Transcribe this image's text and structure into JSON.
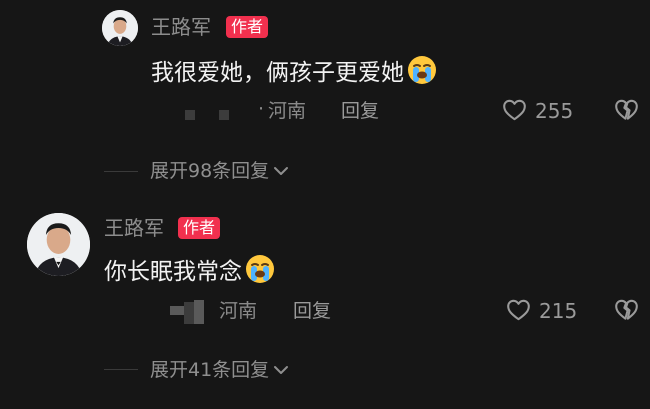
{
  "comments": [
    {
      "author": "王路军",
      "badge": "作者",
      "text": "我很爱她，俩孩子更爱她",
      "emoji": "crying-face-emoji",
      "location_prefix": "·",
      "location": "河南",
      "reply_label": "回复",
      "likes": "255",
      "expand_label": "展开98条回复"
    },
    {
      "author": "王路军",
      "badge": "作者",
      "text": "你长眠我常念",
      "emoji": "crying-face-emoji",
      "location": "河南",
      "reply_label": "回复",
      "likes": "215",
      "expand_label": "展开41条回复"
    }
  ],
  "colors": {
    "background": "#161616",
    "badge": "#f1304e",
    "muted_text": "#8d8d8d",
    "comment_text": "#f2f2f2"
  }
}
